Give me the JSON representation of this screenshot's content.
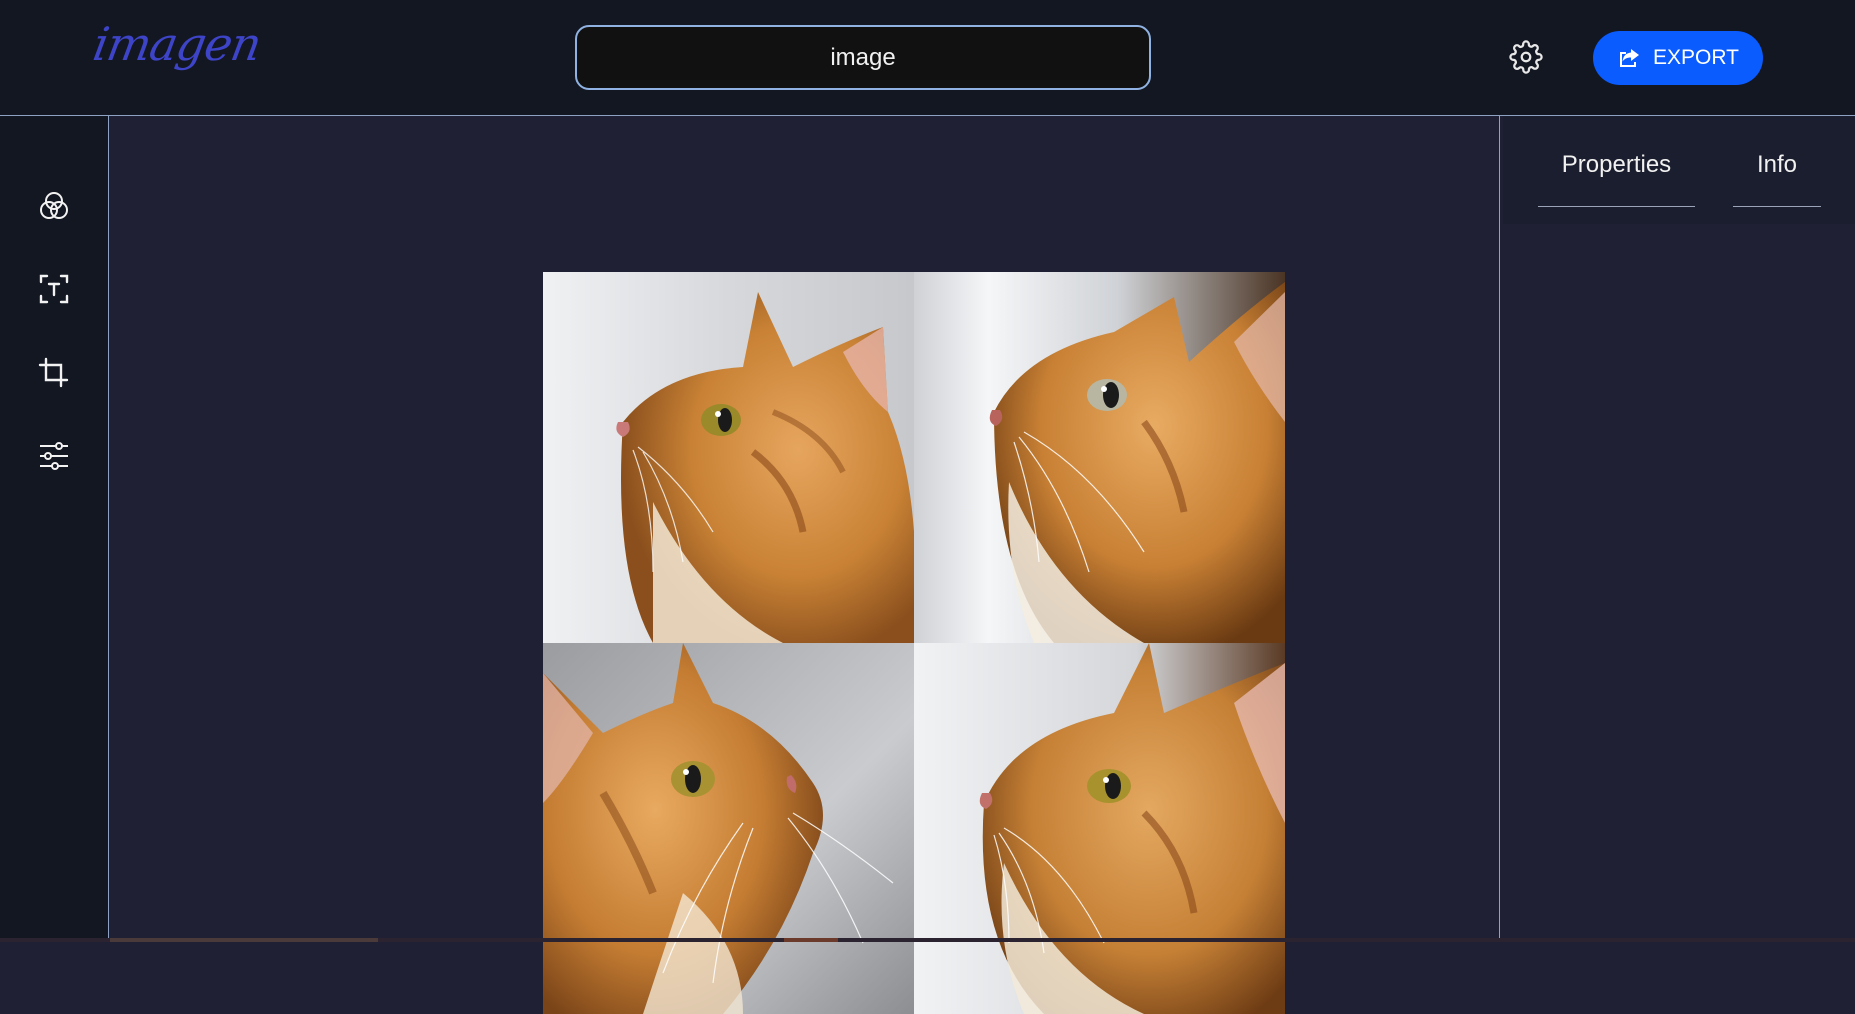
{
  "app": {
    "logo_text": "imagen",
    "logo_color": "#3e44c8"
  },
  "header": {
    "title_value": "image",
    "settings_icon": "gear-icon",
    "export_label": "EXPORT",
    "export_icon": "share-export-icon",
    "accent_color": "#0b5cff"
  },
  "toolbar": {
    "tools": [
      {
        "name": "filters",
        "icon": "color-circles-icon"
      },
      {
        "name": "text",
        "icon": "text-select-icon"
      },
      {
        "name": "crop",
        "icon": "crop-icon"
      },
      {
        "name": "adjust",
        "icon": "sliders-icon"
      }
    ]
  },
  "canvas": {
    "images": [
      {
        "subject": "orange tabby kitten looking up-left"
      },
      {
        "subject": "orange tabby kitten looking up-left"
      },
      {
        "subject": "orange tabby kitten looking up-right"
      },
      {
        "subject": "orange tabby kitten looking up-left"
      }
    ]
  },
  "right_panel": {
    "tabs": [
      {
        "label": "Properties"
      },
      {
        "label": "Info"
      }
    ]
  }
}
